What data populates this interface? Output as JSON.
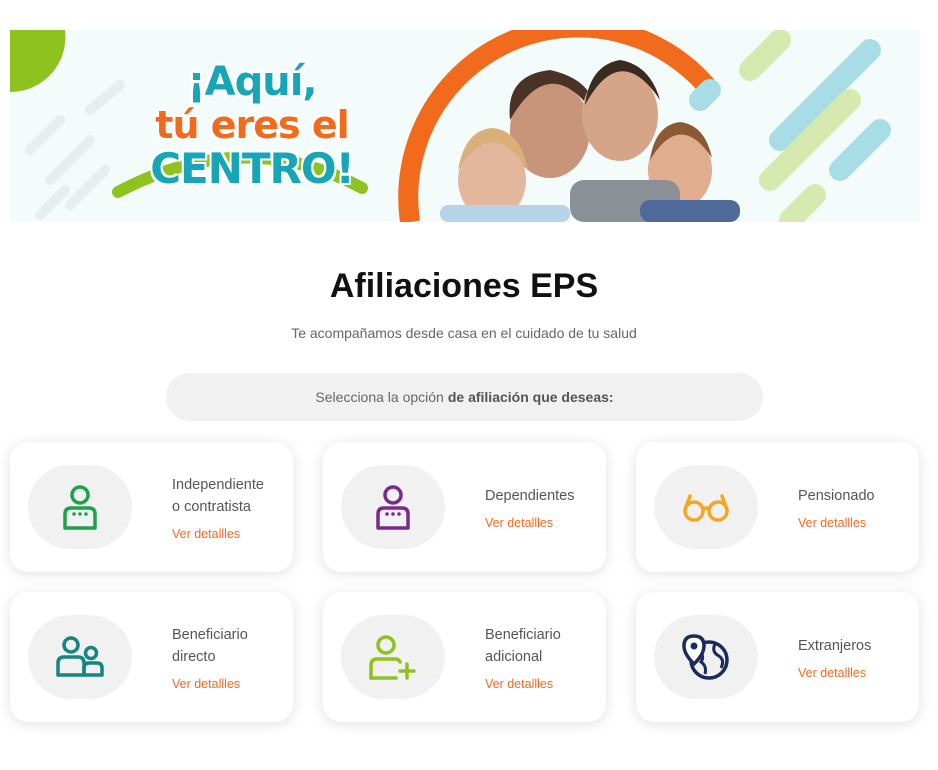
{
  "banner": {
    "headline_line1": "¡Aquí,",
    "headline_line2": "tú eres el",
    "headline_line3": "CENTRO!"
  },
  "page": {
    "title": "Afiliaciones EPS",
    "subtitle": "Te acompañamos desde casa en el cuidado de tu salud"
  },
  "selector": {
    "prefix": "Selecciona la opción",
    "emphasis": "de afiliación que deseas:"
  },
  "cards": [
    {
      "label_line1": "Independiente",
      "label_line2": "o contratista",
      "link": "Ver detallles",
      "icon": "user-badge-icon",
      "color": "#1fa04a"
    },
    {
      "label_line1": "Dependientes",
      "label_line2": "",
      "link": "Ver detallles",
      "icon": "user-badge-icon",
      "color": "#7a2a8c"
    },
    {
      "label_line1": "Pensionado",
      "label_line2": "",
      "link": "Ver detallles",
      "icon": "glasses-icon",
      "color": "#f5a623"
    },
    {
      "label_line1": "Beneficiario",
      "label_line2": "directo",
      "link": "Ver detallles",
      "icon": "family-icon",
      "color": "#14857f"
    },
    {
      "label_line1": "Beneficiario",
      "label_line2": "adicional",
      "link": "Ver detallles",
      "icon": "user-plus-icon",
      "color": "#8dc21f"
    },
    {
      "label_line1": "Extranjeros",
      "label_line2": "",
      "link": "Ver detallles",
      "icon": "globe-pin-icon",
      "color": "#1b2a5e"
    }
  ],
  "colors": {
    "accent_orange": "#f26a1b",
    "accent_teal": "#17a6b8",
    "accent_green": "#8dc21f"
  }
}
